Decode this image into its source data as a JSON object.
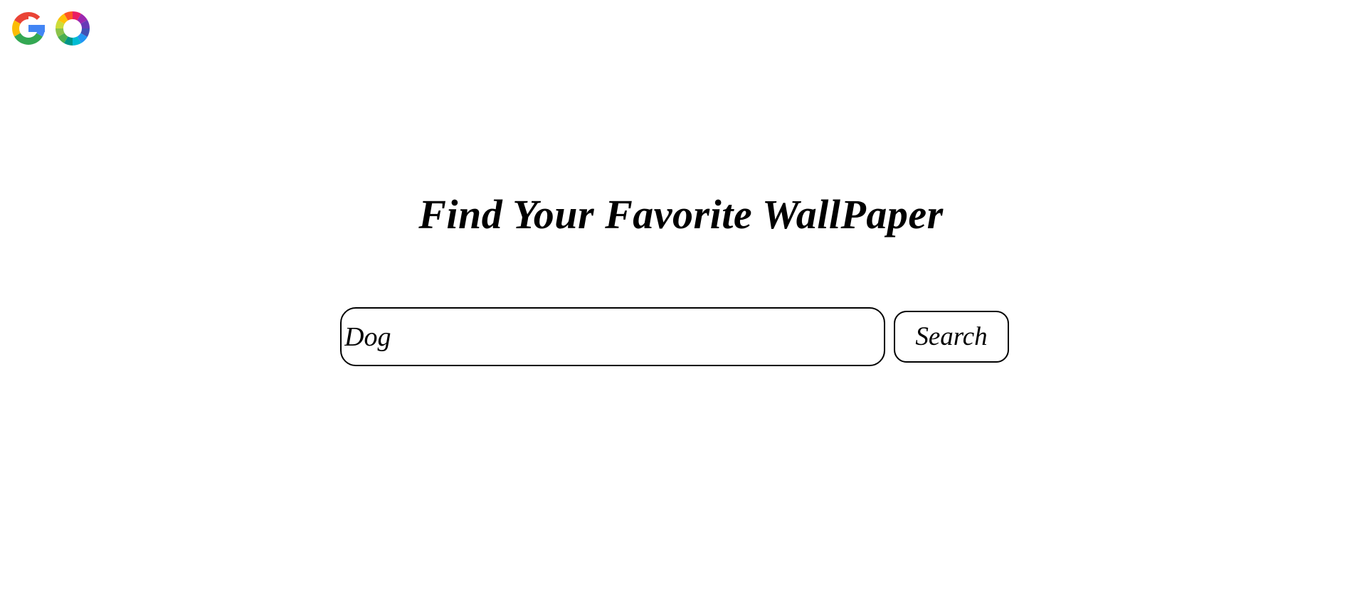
{
  "logo": {
    "letter_g_icon": "google-g-icon",
    "letter_o_icon": "color-wheel-icon",
    "colors": [
      "#EA4335",
      "#FBBC05",
      "#34A853",
      "#4285F4"
    ]
  },
  "header": {
    "title": "Find Your  Favorite WallPaper"
  },
  "search": {
    "value": "Dog",
    "placeholder": "",
    "button_label": "Search"
  }
}
